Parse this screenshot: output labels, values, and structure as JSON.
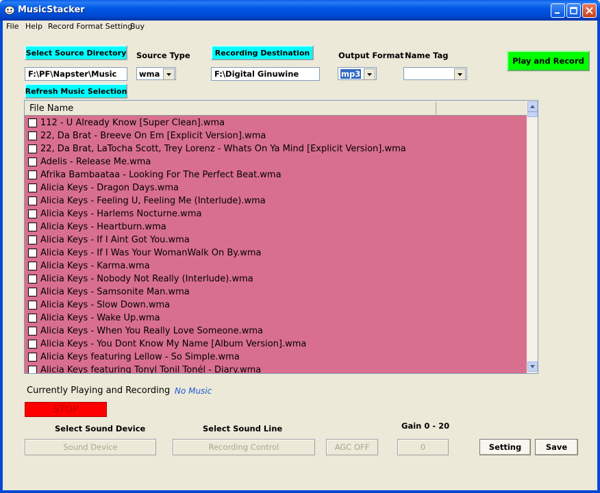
{
  "window": {
    "title": "MusicStacker"
  },
  "menu": [
    "File",
    "Help",
    "Record Format Setting",
    "Buy"
  ],
  "source": {
    "select_label": "Select Source Directory",
    "path": "F:\\PF\\Napster\\Music",
    "refresh_label": "Refresh Music Selection"
  },
  "source_type": {
    "label": "Source Type",
    "value": "wma"
  },
  "destination": {
    "button_label": "Recording Destination",
    "path": "F:\\Digital Ginuwine"
  },
  "output_format": {
    "label": "Output Format",
    "value": "mp3"
  },
  "name_tag": {
    "label": "Name Tag",
    "value": ""
  },
  "play_record_label": "Play and Record",
  "list": {
    "column_header": "File Name",
    "files": [
      "112 - U Already Know [Super Clean].wma",
      "22, Da Brat - Breeve On Em [Explicit Version].wma",
      "22, Da Brat, LaTocha Scott, Trey Lorenz - Whats On Ya Mind [Explicit Version].wma",
      "Adelis - Release Me.wma",
      "Afrika Bambaataa - Looking For The Perfect Beat.wma",
      "Alicia Keys - Dragon Days.wma",
      "Alicia Keys - Feeling U, Feeling Me (Interlude).wma",
      "Alicia Keys - Harlems Nocturne.wma",
      "Alicia Keys - Heartburn.wma",
      "Alicia Keys - If I Aint Got You.wma",
      "Alicia Keys - If I Was Your WomanWalk On By.wma",
      "Alicia Keys - Karma.wma",
      "Alicia Keys - Nobody Not Really (Interlude).wma",
      "Alicia Keys - Samsonite Man.wma",
      "Alicia Keys - Slow Down.wma",
      "Alicia Keys - Wake Up.wma",
      "Alicia Keys - When You Really Love Someone.wma",
      "Alicia Keys - You Dont Know My Name [Album Version].wma",
      "Alicia Keys featuring Lellow - So Simple.wma",
      "Alicia Keys featuring Tonyl Tonil Tonél - Diary.wma"
    ]
  },
  "status": {
    "label": "Currently Playing and Recording",
    "value": "No Music"
  },
  "stop_label": "STOP",
  "sound_device": {
    "label": "Select Sound Device",
    "button": "Sound Device"
  },
  "sound_line": {
    "label": "Select Sound Line",
    "button": "Recording Control"
  },
  "agc_label": "AGC OFF",
  "gain": {
    "label": "Gain 0 - 20",
    "value": "0"
  },
  "setting_label": "Setting",
  "save_label": "Save",
  "colors": {
    "cyan": "#00ffff",
    "list_bg": "#d96f8f",
    "stop": "#ff0000",
    "play_record": "#00ff00",
    "status_value": "#1c5ad8"
  },
  "icons": [
    "app-icon",
    "minimize-icon",
    "maximize-icon",
    "close-icon",
    "dropdown-arrow-icon",
    "scroll-up-icon",
    "scroll-down-icon",
    "checkbox-icon"
  ]
}
